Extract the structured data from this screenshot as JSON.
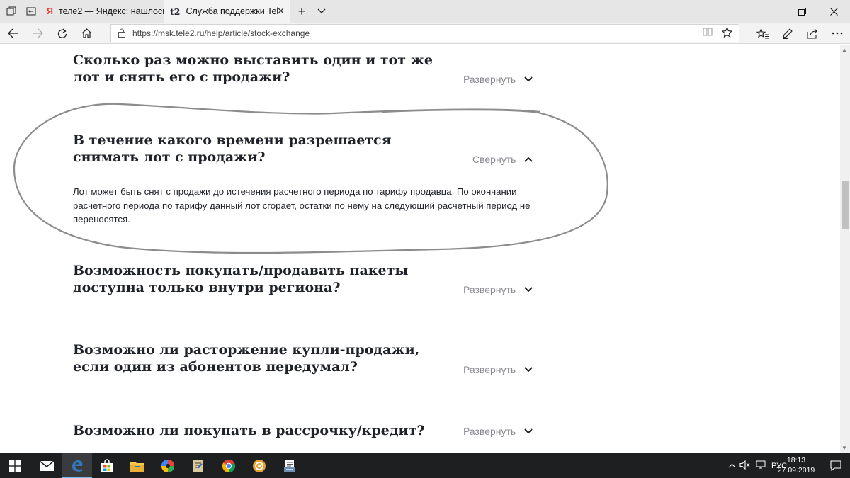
{
  "browser": {
    "tabs": [
      {
        "favicon": "Я",
        "title": "теле2 — Яндекс: нашлось",
        "active": false
      },
      {
        "favicon": "t2",
        "title": "Служба поддержки Tel",
        "active": true
      }
    ],
    "new_tab_icon": "plus-icon",
    "url": "https://msk.tele2.ru/help/article/stock-exchange"
  },
  "faq": [
    {
      "question": "Сколько раз можно выставить один и тот же лот и снять его с продажи?",
      "toggle_label": "Развернуть",
      "expanded": false
    },
    {
      "question": "В течение какого времени разрешается снимать лот с продажи?",
      "toggle_label": "Свернуть",
      "expanded": true,
      "answer": "Лот может быть снят с продажи до истечения расчетного периода по тарифу продавца. По окончании расчетного периода по тарифу данный лот сгорает, остатки по нему на следующий расчетный период не переносятся."
    },
    {
      "question": "Возможность покупать/продавать пакеты доступна только внутри региона?",
      "toggle_label": "Развернуть",
      "expanded": false
    },
    {
      "question": "Возможно ли расторжение купли-продажи, если один из абонентов передумал?",
      "toggle_label": "Развернуть",
      "expanded": false
    },
    {
      "question": "Возможно ли покупать в рассрочку/кредит?",
      "toggle_label": "Развернуть",
      "expanded": false
    }
  ],
  "taskbar": {
    "language": "РУС",
    "time": "18:13",
    "date": "27.09.2019"
  },
  "colors": {
    "text": "#1f2229",
    "toggle": "#8a8c91",
    "annotation": "#8c8c8c",
    "taskbar": "#1e1f21"
  }
}
